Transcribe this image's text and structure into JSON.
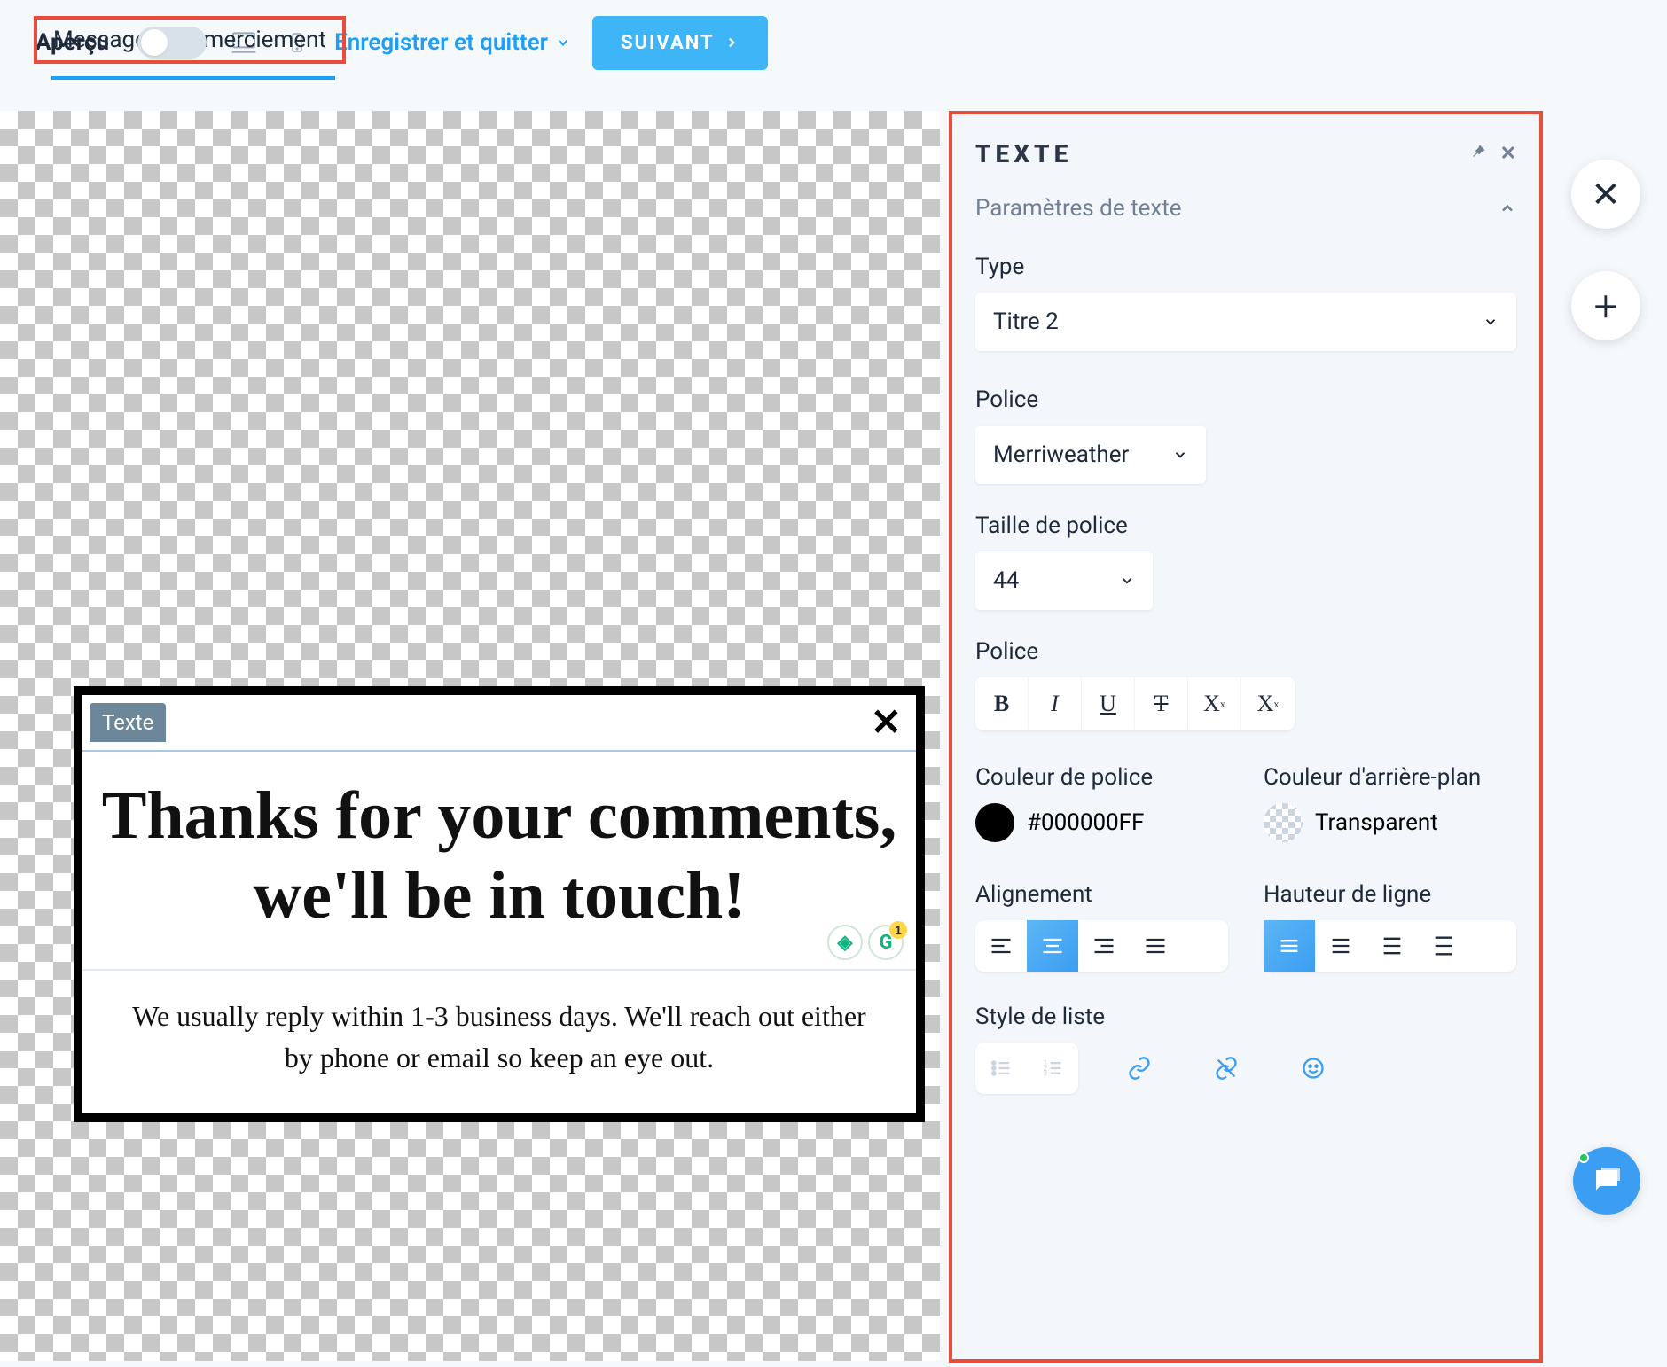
{
  "topbar": {
    "tab": "Message de remerciement",
    "apercu": "Aperçu",
    "save": "Enregistrer et quitter",
    "next": "SUIVANT"
  },
  "popup": {
    "tab": "Texte",
    "title": "Thanks for your comments, we'll be in touch!",
    "body": "We usually reply within 1-3 business days. We'll reach out either by phone or email so keep an eye out.",
    "grammarly_count": "1"
  },
  "inspector": {
    "title": "TEXTE",
    "section": "Paramètres de texte",
    "type_label": "Type",
    "type_value": "Titre 2",
    "font_label": "Police",
    "font_value": "Merriweather",
    "size_label": "Taille de police",
    "size_value": "44",
    "style_label": "Police",
    "font_color_label": "Couleur de police",
    "font_color_value": "#000000FF",
    "bg_color_label": "Couleur d'arrière-plan",
    "bg_color_value": "Transparent",
    "align_label": "Alignement",
    "line_height_label": "Hauteur de ligne",
    "list_style_label": "Style de liste"
  }
}
